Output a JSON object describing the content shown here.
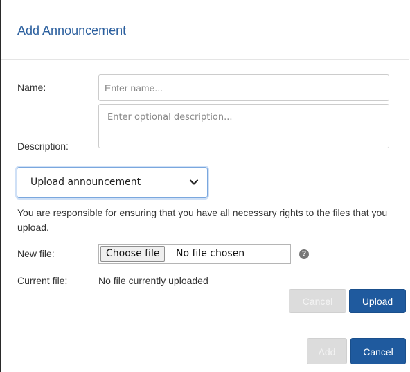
{
  "dialog": {
    "title": "Add Announcement"
  },
  "form": {
    "name_label": "Name:",
    "name_placeholder": "Enter name...",
    "description_label": "Description:",
    "description_placeholder": "Enter optional description...",
    "mode_select_value": "Upload announcement",
    "notice": "You are responsible for ensuring that you have all necessary rights to the files that you upload.",
    "new_file_label": "New file:",
    "choose_file_label": "Choose file",
    "no_file_chosen": "No file chosen",
    "help_glyph": "?",
    "current_file_label": "Current file:",
    "current_file_value": "No file currently uploaded"
  },
  "upload_actions": {
    "cancel_label": "Cancel",
    "upload_label": "Upload"
  },
  "footer": {
    "add_label": "Add",
    "cancel_label": "Cancel"
  },
  "icons": {
    "select_chevron": "chevron-down-icon",
    "help": "question-circle-icon"
  },
  "colors": {
    "title": "#2b5f9e",
    "primary_button": "#1f5a9e",
    "disabled_button": "#dcdcdc",
    "select_focus": "#7aa7de"
  }
}
